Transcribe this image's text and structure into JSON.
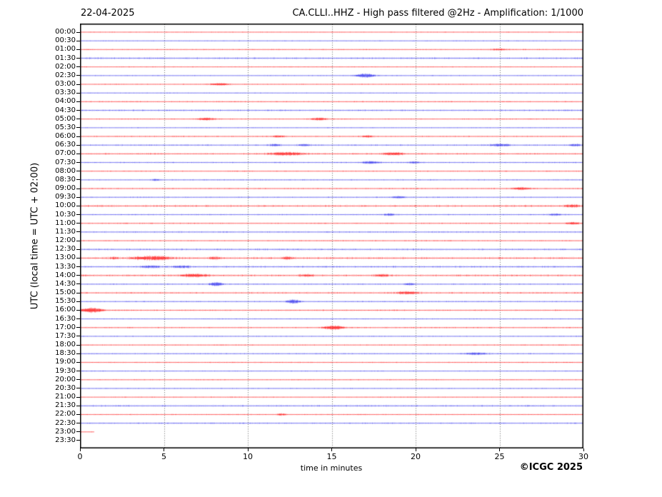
{
  "chart_data": {
    "type": "line",
    "subtype": "helicorder-seismogram",
    "date_label": "22-04-2025",
    "title": "CA.CLLI..HHZ - High pass filtered @2Hz - Amplification: 1/1000",
    "ylabel": "UTC (local time = UTC + 02:00)",
    "xlabel": "time in minutes",
    "credit": "©ICGC 2025",
    "xlim": [
      0,
      30
    ],
    "x_ticks": [
      0,
      5,
      10,
      15,
      20,
      25,
      30
    ],
    "grid_minutes": [
      5,
      10,
      15,
      20,
      25
    ],
    "grid_on": true,
    "colors": {
      "red_trace": "#ff0000",
      "blue_trace": "#2222ee",
      "frame": "#000000",
      "grid": "#444444",
      "background": "#ffffff"
    },
    "rows": [
      {
        "label": "00:00",
        "color": "red",
        "noise": 0.55,
        "events": []
      },
      {
        "label": "00:30",
        "color": "blue",
        "noise": 0.55,
        "events": []
      },
      {
        "label": "01:00",
        "color": "red",
        "noise": 0.8,
        "events": [
          [
            25.0,
            0.8,
            1.0
          ]
        ]
      },
      {
        "label": "01:30",
        "color": "blue",
        "noise": 1.4,
        "events": []
      },
      {
        "label": "02:00",
        "color": "red",
        "noise": 0.6,
        "events": []
      },
      {
        "label": "02:30",
        "color": "blue",
        "noise": 0.7,
        "events": [
          [
            17.0,
            0.7,
            2.8
          ]
        ]
      },
      {
        "label": "03:00",
        "color": "red",
        "noise": 0.7,
        "events": [
          [
            8.3,
            0.9,
            1.4
          ]
        ]
      },
      {
        "label": "03:30",
        "color": "blue",
        "noise": 0.6,
        "events": []
      },
      {
        "label": "04:00",
        "color": "red",
        "noise": 0.9,
        "events": []
      },
      {
        "label": "04:30",
        "color": "blue",
        "noise": 1.2,
        "events": []
      },
      {
        "label": "05:00",
        "color": "red",
        "noise": 0.8,
        "events": [
          [
            7.5,
            0.7,
            1.6
          ],
          [
            14.2,
            0.7,
            1.6
          ]
        ]
      },
      {
        "label": "05:30",
        "color": "blue",
        "noise": 0.6,
        "events": []
      },
      {
        "label": "06:00",
        "color": "red",
        "noise": 0.9,
        "events": [
          [
            11.8,
            0.6,
            1.2
          ],
          [
            17.1,
            0.6,
            1.2
          ]
        ]
      },
      {
        "label": "06:30",
        "color": "blue",
        "noise": 1.0,
        "events": [
          [
            11.6,
            0.5,
            1.3
          ],
          [
            13.3,
            0.5,
            1.3
          ],
          [
            25.0,
            0.9,
            1.6
          ],
          [
            29.5,
            0.5,
            1.4
          ]
        ]
      },
      {
        "label": "07:00",
        "color": "red",
        "noise": 1.2,
        "events": [
          [
            12.3,
            1.4,
            2.2
          ],
          [
            18.7,
            0.8,
            1.8
          ]
        ]
      },
      {
        "label": "07:30",
        "color": "blue",
        "noise": 0.9,
        "events": [
          [
            17.3,
            0.7,
            1.7
          ],
          [
            19.9,
            0.5,
            1.2
          ]
        ]
      },
      {
        "label": "08:00",
        "color": "red",
        "noise": 0.8,
        "events": []
      },
      {
        "label": "08:30",
        "color": "blue",
        "noise": 0.8,
        "events": [
          [
            4.5,
            0.5,
            1.0
          ]
        ]
      },
      {
        "label": "09:00",
        "color": "red",
        "noise": 0.9,
        "events": [
          [
            26.3,
            0.8,
            1.6
          ]
        ]
      },
      {
        "label": "09:30",
        "color": "blue",
        "noise": 0.9,
        "events": [
          [
            19.0,
            0.6,
            1.3
          ]
        ]
      },
      {
        "label": "10:00",
        "color": "red",
        "noise": 1.5,
        "events": [
          [
            29.3,
            0.7,
            1.5
          ]
        ]
      },
      {
        "label": "10:30",
        "color": "blue",
        "noise": 0.9,
        "events": [
          [
            18.4,
            0.5,
            1.4
          ],
          [
            28.3,
            0.6,
            1.3
          ]
        ]
      },
      {
        "label": "11:00",
        "color": "red",
        "noise": 0.9,
        "events": [
          [
            29.3,
            0.6,
            1.5
          ]
        ]
      },
      {
        "label": "11:30",
        "color": "blue",
        "noise": 1.1,
        "events": []
      },
      {
        "label": "12:00",
        "color": "red",
        "noise": 0.8,
        "events": []
      },
      {
        "label": "12:30",
        "color": "blue",
        "noise": 1.3,
        "events": []
      },
      {
        "label": "13:00",
        "color": "red",
        "noise": 1.6,
        "events": [
          [
            2.0,
            0.4,
            1.2
          ],
          [
            4.3,
            1.5,
            2.8
          ],
          [
            8.0,
            0.5,
            1.5
          ],
          [
            12.4,
            0.5,
            1.5
          ]
        ]
      },
      {
        "label": "13:30",
        "color": "blue",
        "noise": 1.4,
        "events": [
          [
            4.2,
            0.8,
            1.6
          ],
          [
            6.0,
            0.8,
            1.4
          ]
        ]
      },
      {
        "label": "14:00",
        "color": "red",
        "noise": 1.4,
        "events": [
          [
            6.8,
            1.1,
            2.0
          ],
          [
            13.5,
            0.6,
            1.4
          ],
          [
            18.0,
            0.6,
            1.4
          ]
        ]
      },
      {
        "label": "14:30",
        "color": "blue",
        "noise": 0.9,
        "events": [
          [
            8.1,
            0.55,
            2.6
          ],
          [
            19.6,
            0.5,
            1.2
          ]
        ]
      },
      {
        "label": "15:00",
        "color": "red",
        "noise": 1.2,
        "events": [
          [
            19.5,
            1.0,
            1.6
          ]
        ]
      },
      {
        "label": "15:30",
        "color": "blue",
        "noise": 0.9,
        "events": [
          [
            12.7,
            0.55,
            2.6
          ]
        ]
      },
      {
        "label": "16:00",
        "color": "red",
        "noise": 1.0,
        "events": [
          [
            0.7,
            0.9,
            3.2
          ]
        ]
      },
      {
        "label": "16:30",
        "color": "blue",
        "noise": 0.7,
        "events": []
      },
      {
        "label": "17:00",
        "color": "red",
        "noise": 0.9,
        "events": [
          [
            15.1,
            0.8,
            3.0
          ]
        ]
      },
      {
        "label": "17:30",
        "color": "blue",
        "noise": 0.7,
        "events": []
      },
      {
        "label": "18:00",
        "color": "red",
        "noise": 0.8,
        "events": []
      },
      {
        "label": "18:30",
        "color": "blue",
        "noise": 0.9,
        "events": [
          [
            23.6,
            1.0,
            1.4
          ]
        ]
      },
      {
        "label": "19:00",
        "color": "red",
        "noise": 0.8,
        "events": []
      },
      {
        "label": "19:30",
        "color": "blue",
        "noise": 0.7,
        "events": []
      },
      {
        "label": "20:00",
        "color": "red",
        "noise": 0.7,
        "events": []
      },
      {
        "label": "20:30",
        "color": "blue",
        "noise": 0.7,
        "events": []
      },
      {
        "label": "21:00",
        "color": "red",
        "noise": 0.7,
        "events": []
      },
      {
        "label": "21:30",
        "color": "blue",
        "noise": 1.3,
        "events": []
      },
      {
        "label": "22:00",
        "color": "red",
        "noise": 0.8,
        "events": [
          [
            12.0,
            0.4,
            1.3
          ]
        ]
      },
      {
        "label": "22:30",
        "color": "blue",
        "noise": 1.0,
        "events": []
      },
      {
        "label": "23:00",
        "color": "red",
        "noise": 0.6,
        "events": [],
        "coverage": 0.028
      },
      {
        "label": "23:30",
        "color": "blue",
        "noise": 0,
        "events": [],
        "coverage": 0
      }
    ]
  }
}
